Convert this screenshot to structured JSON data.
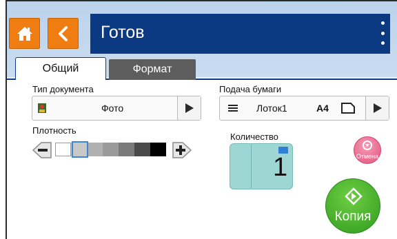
{
  "header": {
    "title": "Готов",
    "home_icon": "home-icon",
    "back_icon": "chevron-left-icon",
    "menu_icon": "more-vertical-icon",
    "accent": "#ef7d12",
    "bar_color": "#0b3a82"
  },
  "tabs": [
    {
      "label": "Общий",
      "selected": true
    },
    {
      "label": "Формат",
      "selected": false
    }
  ],
  "document_type": {
    "label": "Тип документа",
    "value": "Фото",
    "icon": "photo-icon"
  },
  "paper_feed": {
    "label": "Подача бумаги",
    "tray": "Лоток1",
    "size": "A4",
    "tray_icon": "tray-icon",
    "orientation_icon": "landscape-paper-icon"
  },
  "density": {
    "label": "Плотность",
    "steps": 7,
    "selected_step": 2,
    "colors": [
      "#ffffff",
      "#c8c8c8",
      "#b0b0b0",
      "#9a9a9a",
      "#7a7a7a",
      "#4a4a4a",
      "#000000"
    ]
  },
  "quantity": {
    "label": "Количество",
    "value": "1"
  },
  "cancel": {
    "label": "Отмена"
  },
  "copy": {
    "label": "Копия"
  }
}
